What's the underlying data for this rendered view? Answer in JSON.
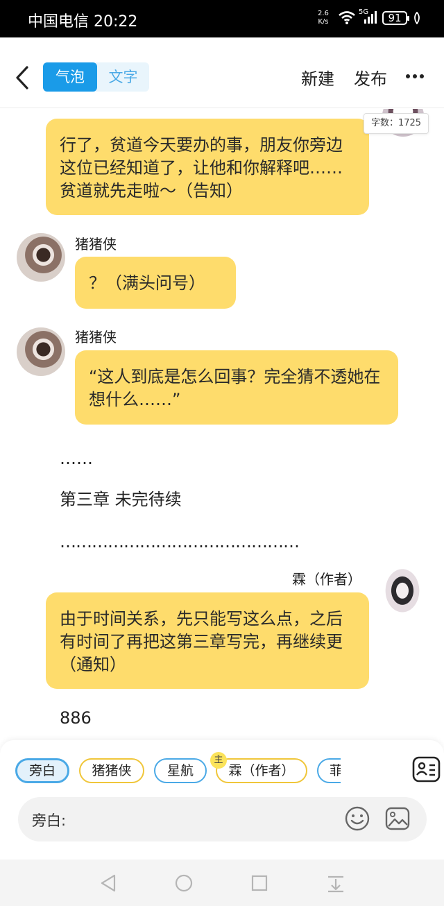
{
  "status_bar": {
    "carrier": "中国电信",
    "time": "20:22",
    "speed_value": "2.6",
    "speed_unit": "K/s",
    "network": "5G",
    "battery": "91"
  },
  "header": {
    "mode_bubble": "气泡",
    "mode_text": "文字",
    "new_label": "新建",
    "publish_label": "发布"
  },
  "word_count": "字数：1725",
  "messages": [
    {
      "text": "行了，贫道今天要办的事，朋友你旁边这位已经知道了，让他和你解释吧……贫道就先走啦～（告知）"
    },
    {
      "name": "猪猪侠",
      "text": "？（满头问号）"
    },
    {
      "name": "猪猪侠",
      "text": "“这人到底是怎么回事？完全猜不透她在想什么……”"
    },
    {
      "text": "由于时间关系，先只能写这么点，之后有时间了再把这第三章写完，再继续更（通知）",
      "name": "霖（作者）"
    }
  ],
  "narration": {
    "dots_short": "……",
    "chapter": "第三章 未完待续",
    "dots_long": "………………………………………",
    "closing": "886"
  },
  "roles": [
    {
      "label": "旁白",
      "style": "active"
    },
    {
      "label": "猪猪侠",
      "style": "gold"
    },
    {
      "label": "星航",
      "style": "blue"
    },
    {
      "label": "霖（作者）",
      "style": "gold"
    },
    {
      "label": "菲",
      "style": "blue"
    }
  ],
  "main_badge": "主",
  "composer": {
    "input_label": "旁白:"
  },
  "colors": {
    "bubble": "#fedc6c",
    "accent": "#1a9be8",
    "chip_gold": "#f0c63a"
  },
  "icons": [
    "back-icon",
    "more-icon",
    "roles-list-icon",
    "emoji-icon",
    "image-icon",
    "nav-back-icon",
    "nav-home-icon",
    "nav-recents-icon",
    "nav-menu-icon"
  ]
}
